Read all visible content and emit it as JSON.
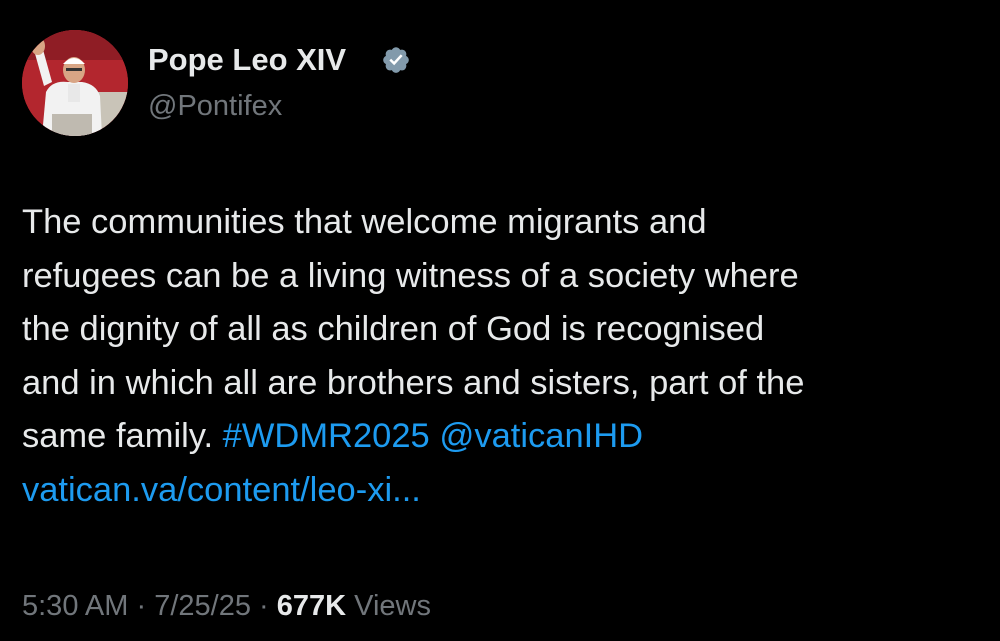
{
  "author": {
    "name": "Pope Leo XIV",
    "handle": "@Pontifex",
    "verified": true,
    "avatar": "pope-waving-photo"
  },
  "tweet": {
    "lines": [
      "The communities that welcome migrants and",
      "refugees can be a living witness of a society where",
      "the dignity of all as children of God is recognised",
      "and in which all are brothers and sisters, part of the"
    ],
    "last_line_prefix": "same family. ",
    "hashtag": "#WDMR2025",
    "mention": "@vaticanIHD",
    "link": "vatican.va/content/leo-xi..."
  },
  "meta": {
    "time": "5:30 AM",
    "date": "7/25/25",
    "separator": "·",
    "views_count": "677K",
    "views_label": "Views"
  },
  "colors": {
    "background": "#000000",
    "text": "#e7e9ea",
    "secondary": "#71767b",
    "link": "#1d9bf0",
    "verified_badge": "#829aab"
  }
}
